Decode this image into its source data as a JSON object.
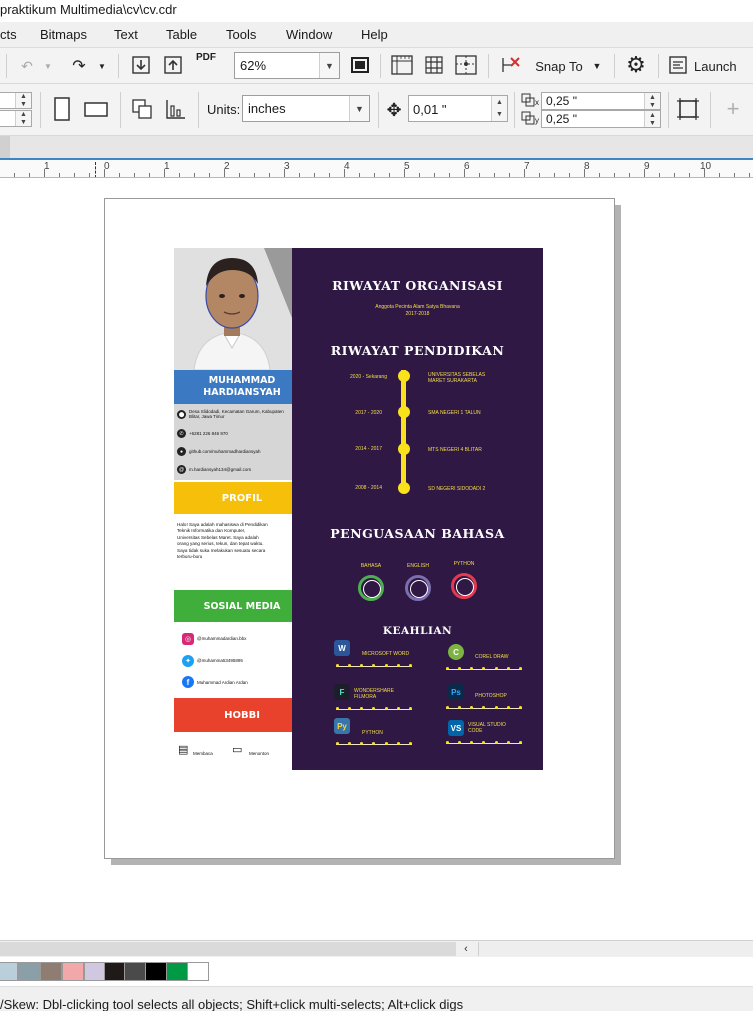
{
  "window": {
    "title": "praktikum Multimedia\\cv\\cv.cdr"
  },
  "menu": {
    "items": [
      {
        "label": "cts"
      },
      {
        "label": "Bitmaps"
      },
      {
        "label": "Text"
      },
      {
        "label": "Table"
      },
      {
        "label": "Tools"
      },
      {
        "label": "Window"
      },
      {
        "label": "Help"
      }
    ]
  },
  "toolbar": {
    "zoom_value": "62%",
    "pdf_label": "PDF",
    "snap_label": "Snap To",
    "launch_label": "Launch",
    "units_label": "Units:",
    "units_value": "inches",
    "nudge_value": "0,01 \"",
    "dup_x_value": "0,25 \"",
    "dup_y_value": "0,25 \"",
    "dup_x_axis": "x",
    "dup_y_axis": "y"
  },
  "ruler": {
    "labels": [
      "1",
      "0",
      "1",
      "2",
      "3",
      "4",
      "5",
      "6",
      "7",
      "8",
      "9",
      "10"
    ]
  },
  "cv": {
    "name_line1": "MUHAMMAD",
    "name_line2": "HARDIANSYAH",
    "contact": {
      "address": "Desa Slidodadi, Kecamatan Garum, Kabupaten Blitar, Jawa Timur",
      "phone": "+6281 226 846 970",
      "github": "github.com/muhammadhardiansyah",
      "email": "m.hardiansyah134@gmail.com"
    },
    "profil_title": "PROFIL",
    "profil_text": "Halo! Saya adalah mahasiswa di Pendidikan Teknik Informatika dan Komputer, Universitas Sebelas Maret. Saya adalah orang yang serius, tekun, dan tepat waktu. Saya tidak suka melakukan sesuatu secara terburu-buru",
    "social_title": "SOSIAL MEDIA",
    "social": {
      "instagram": "@muhammadardian.bbx",
      "twitter": "@muhamma53495895",
      "facebook": "Muhammad Ardian Ardan"
    },
    "hobbi_title": "HOBBI",
    "hobbi": {
      "item1": "Membaca",
      "item2": "Menonton"
    },
    "organisasi_title": "RIWAYAT ORGANISASI",
    "organisasi_line1": "Anggota Pecinta Alam Satya Bhavana",
    "organisasi_line2": "2017-2018",
    "pendidikan_title": "RIWAYAT PENDIDIKAN",
    "pendidikan": [
      {
        "date": "2020 - Sekarang",
        "school": "UNIVERSITAS SEBELAS MARET SURAKARTA"
      },
      {
        "date": "2017 - 2020",
        "school": "SMA NEGERI 1 TALUN"
      },
      {
        "date": "2014 - 2017",
        "school": "MTS NEGERI 4 BLITAR"
      },
      {
        "date": "2008 - 2014",
        "school": "SD NEGERI SIDODADI 2"
      }
    ],
    "bahasa_title": "PENGUASAAN BAHASA",
    "bahasa": [
      {
        "label": "BAHASA",
        "color": "#4caf50"
      },
      {
        "label": "ENGLISH",
        "color": "#7b6fb0"
      },
      {
        "label": "PYTHON",
        "color": "#e53950"
      }
    ],
    "keahlian_title": "KEAHLIAN",
    "keahlian": [
      {
        "name": "MICROSOFT WORD",
        "icon": "W",
        "color": "#2b579a"
      },
      {
        "name": "COREL DRAW",
        "icon": "C",
        "color": "#7cb342"
      },
      {
        "name": "WONDERSHARE FILMORA",
        "icon": "F",
        "color": "#1d1d2b"
      },
      {
        "name": "PHOTOSHOP",
        "icon": "Ps",
        "color": "#0b2a4a"
      },
      {
        "name": "PYTHON",
        "icon": "Py",
        "color": "#3776ab"
      },
      {
        "name": "VISUAL STUDIO CODE",
        "icon": "VS",
        "color": "#0065a9"
      }
    ]
  },
  "palette": {
    "colors": [
      "#b9cfd9",
      "#8b9fa8",
      "#8f7d72",
      "#f2a8a8",
      "#cfc8e0",
      "#1f1a17",
      "#4a4a4a",
      "#000000",
      "#009a44",
      "#ffffff"
    ]
  },
  "status": {
    "text": "/Skew: Dbl-clicking tool selects all objects; Shift+click multi-selects; Alt+click digs"
  }
}
